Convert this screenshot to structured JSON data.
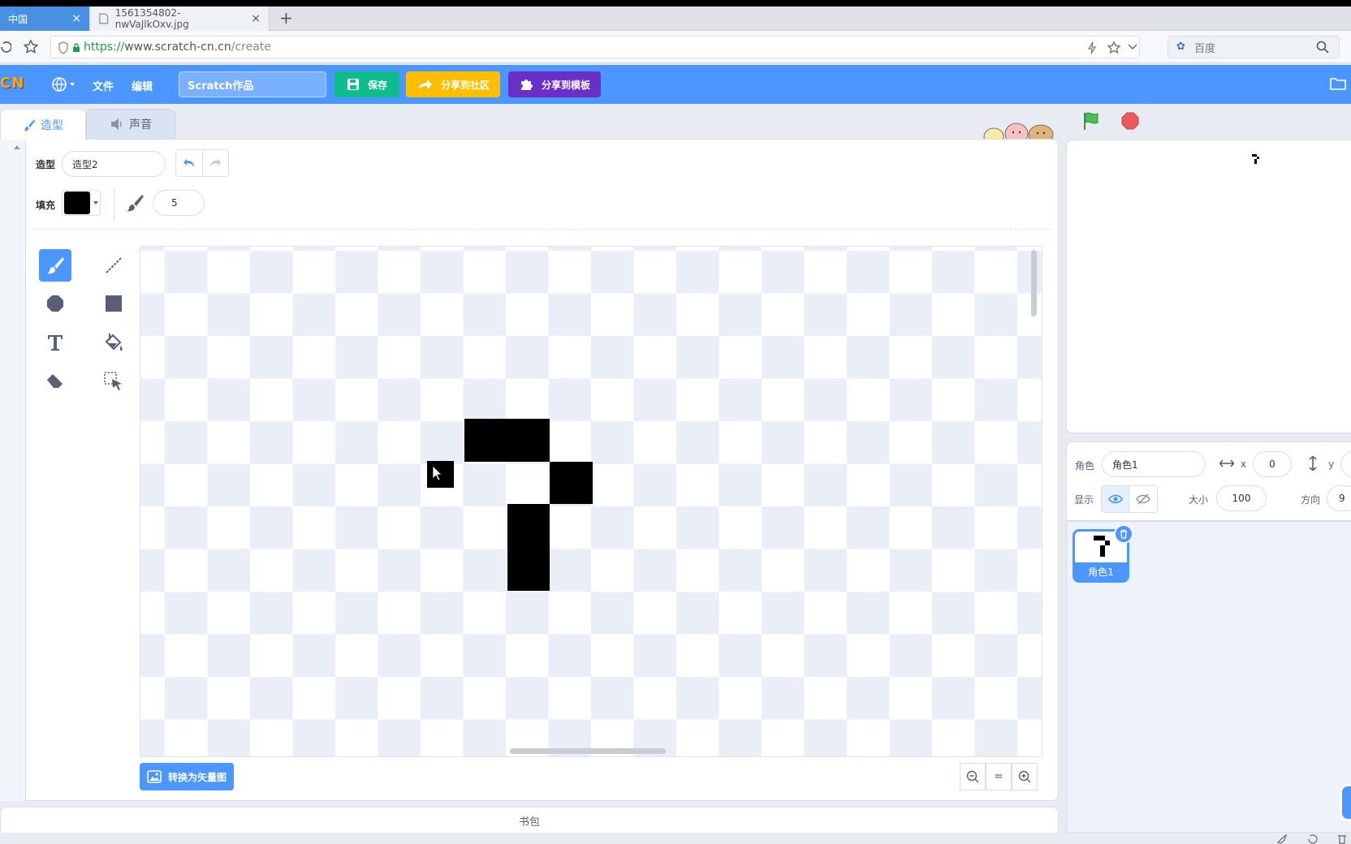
{
  "browser": {
    "tabs": [
      {
        "label": "中国"
      },
      {
        "label": "1561354802-nwVaJlkOxv.jpg"
      }
    ],
    "url_scheme": "https://",
    "url_host": "www.scratch-cn.cn",
    "url_path": "/create",
    "search_placeholder": "百度"
  },
  "menu": {
    "logo": "CN",
    "file": "文件",
    "edit": "编辑",
    "project_title": "Scratch作品",
    "save": "保存",
    "share_community": "分享到社区",
    "share_template": "分享到模板"
  },
  "editor_tabs": {
    "costumes": "造型",
    "sounds": "声音"
  },
  "paint": {
    "costume_label": "造型",
    "costume_name": "造型2",
    "fill_label": "填充",
    "fill_color": "#000000",
    "brush_size": "5",
    "convert_button": "转换为矢量图",
    "zoom_reset": "="
  },
  "backpack": "书包",
  "sprite_info": {
    "sprite_label": "角色",
    "sprite_name": "角色1",
    "x_label": "x",
    "x_value": "0",
    "y_label": "y",
    "show_label": "显示",
    "size_label": "大小",
    "size_value": "100",
    "direction_label": "方向",
    "direction_value": "9"
  },
  "sprites": [
    {
      "name": "角色1"
    }
  ],
  "colors": {
    "scratch_blue": "#4c97ff",
    "save_green": "#0fbd8c",
    "share_orange": "#ffbf00",
    "template_purple": "#6a2fc6"
  }
}
